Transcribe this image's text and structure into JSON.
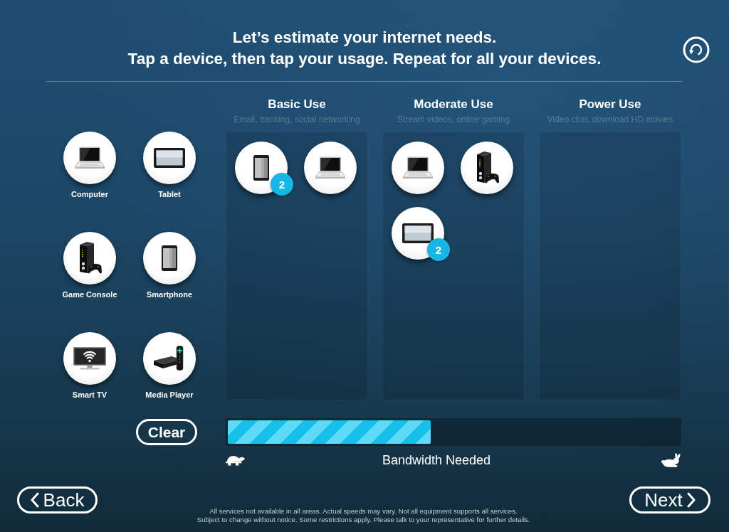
{
  "header": {
    "lines": [
      "Let’s estimate your internet needs.",
      "Tap a device, then tap your usage. Repeat for all your devices."
    ]
  },
  "devices": [
    {
      "kind": "computer",
      "label": "Computer"
    },
    {
      "kind": "tablet",
      "label": "Tablet"
    },
    {
      "kind": "game_console",
      "label": "Game Console"
    },
    {
      "kind": "smartphone",
      "label": "Smartphone"
    },
    {
      "kind": "smart_tv",
      "label": "Smart TV"
    },
    {
      "kind": "media_player",
      "label": "Media Player"
    }
  ],
  "usage_columns": [
    {
      "title": "Basic Use",
      "subtitle": "Email, banking, social networking",
      "devices": [
        {
          "kind": "smartphone",
          "count": "2"
        },
        {
          "kind": "computer"
        }
      ]
    },
    {
      "title": "Moderate Use",
      "subtitle": "Stream videos, online gaming",
      "devices": [
        {
          "kind": "computer"
        },
        {
          "kind": "game_console"
        },
        {
          "kind": "tablet",
          "count": "2"
        }
      ]
    },
    {
      "title": "Power Use",
      "subtitle": "Video chat, download HD movies"
    }
  ],
  "clear_button": {
    "label": "Clear"
  },
  "bandwidth": {
    "label": "Bandwidth Needed",
    "level": 0.45
  },
  "navigation": {
    "back": "Back",
    "next": "Next"
  },
  "disclaimer": [
    "All services not available in all areas. Actual speeds may vary. Not all equipment supports all services.",
    "Subject to change without notice. Some restrictions apply. Please talk to your representative for further details."
  ]
}
